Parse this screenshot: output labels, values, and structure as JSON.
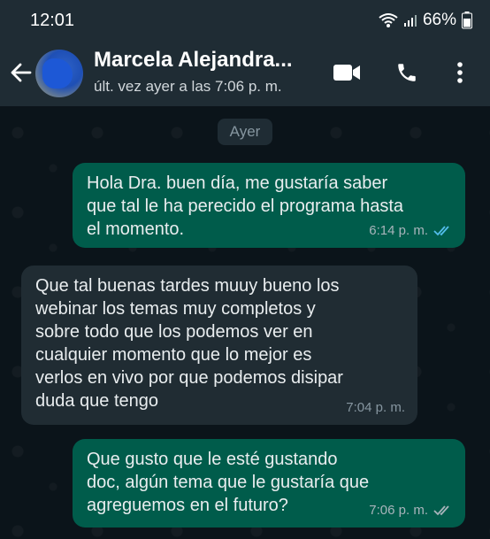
{
  "status_bar": {
    "time": "12:01",
    "battery": "66%"
  },
  "header": {
    "contact_name": "Marcela Alejandra...",
    "last_seen": "últ. vez ayer a las 7:06 p. m."
  },
  "chat": {
    "date_chip": "Ayer",
    "messages": [
      {
        "direction": "outgoing",
        "lines": [
          "Hola Dra. buen día, me gustaría saber",
          "que tal le ha perecido el programa hasta",
          "el momento."
        ],
        "time": "6:14 p. m.",
        "status": "read"
      },
      {
        "direction": "incoming",
        "lines": [
          "Que tal buenas tardes muuy bueno los",
          "webinar los temas muy completos y",
          "sobre todo que los podemos ver en",
          "cualquier momento que lo mejor es",
          "verlos en vivo por que podemos disipar",
          "duda que tengo"
        ],
        "time": "7:04 p. m."
      },
      {
        "direction": "outgoing",
        "lines": [
          "Que gusto que le esté gustando",
          "doc, algún tema que le gustaría que",
          "agreguemos en el futuro?"
        ],
        "time": "7:06 p. m.",
        "status": "delivered"
      }
    ]
  },
  "colors": {
    "outgoing": "#005c4b",
    "incoming": "#202c33",
    "read_ticks": "#53bdeb"
  }
}
